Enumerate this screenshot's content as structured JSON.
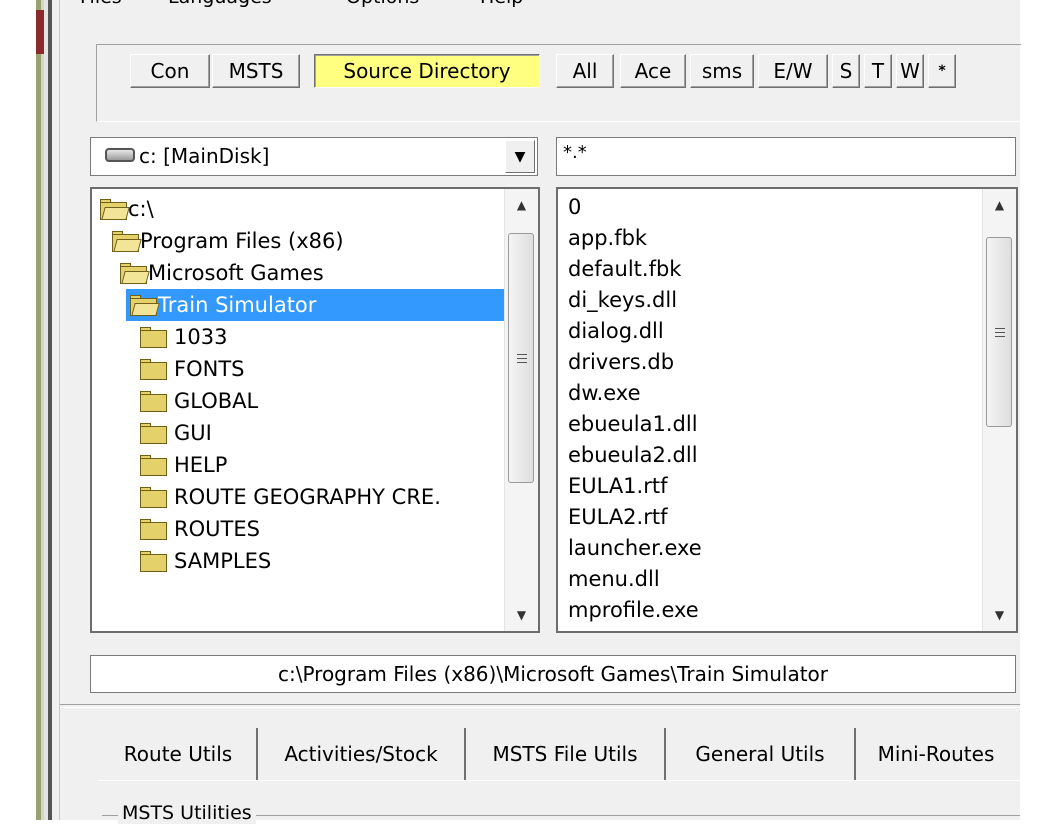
{
  "menu": [
    "Files",
    "Languages",
    "Options",
    "Help"
  ],
  "toolbar": {
    "buttons": [
      "Con",
      "MSTS",
      "Source Directory",
      "All",
      "Ace",
      "sms",
      "E/W",
      "S",
      "T",
      "W",
      "*"
    ],
    "active": "Source Directory",
    "active_color": "#ffff80"
  },
  "drive_select": {
    "value": "c: [MainDisk]",
    "icon": "drive-icon"
  },
  "file_filter": {
    "value": "*.*"
  },
  "dir_list": {
    "items": [
      {
        "label": "c:\\",
        "indent": 0,
        "open": true
      },
      {
        "label": "Program Files (x86)",
        "indent": 1,
        "open": true
      },
      {
        "label": "Microsoft Games",
        "indent": 2,
        "open": true
      },
      {
        "label": "Train Simulator",
        "indent": 3,
        "open": true,
        "selected": true
      },
      {
        "label": "1033",
        "indent": 4
      },
      {
        "label": "FONTS",
        "indent": 4
      },
      {
        "label": "GLOBAL",
        "indent": 4
      },
      {
        "label": "GUI",
        "indent": 4
      },
      {
        "label": "HELP",
        "indent": 4
      },
      {
        "label": "ROUTE GEOGRAPHY CRE.",
        "indent": 4
      },
      {
        "label": "ROUTES",
        "indent": 4
      },
      {
        "label": "SAMPLES",
        "indent": 4
      }
    ],
    "selection_color": "#3399ff"
  },
  "file_list": {
    "items": [
      "0",
      "app.fbk",
      "default.fbk",
      "di_keys.dll",
      "dialog.dll",
      "drivers.db",
      "dw.exe",
      "ebueula1.dll",
      "ebueula2.dll",
      "EULA1.rtf",
      "EULA2.rtf",
      "launcher.exe",
      "menu.dll",
      "mprofile.exe"
    ]
  },
  "path_field": {
    "value": "c:\\Program Files (x86)\\Microsoft Games\\Train Simulator"
  },
  "tabs": [
    "Route Utils",
    "Activities/Stock",
    "MSTS File Utils",
    "General Utils",
    "Mini-Routes"
  ],
  "groupbox": {
    "label": "MSTS Utilities"
  }
}
